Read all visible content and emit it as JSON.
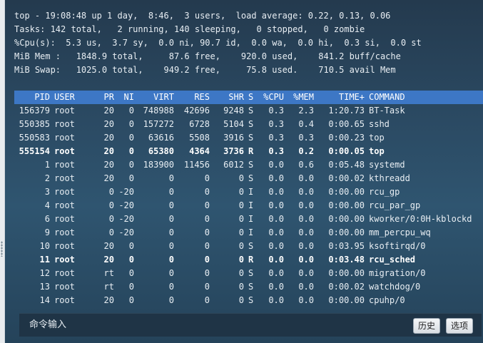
{
  "summary": [
    "top - 19:08:48 up 1 day,  8:46,  3 users,  load average: 0.22, 0.13, 0.06",
    "Tasks: 142 total,   2 running, 140 sleeping,   0 stopped,   0 zombie",
    "%Cpu(s):  5.3 us,  3.7 sy,  0.0 ni, 90.7 id,  0.0 wa,  0.0 hi,  0.3 si,  0.0 st",
    "MiB Mem :   1848.9 total,     87.6 free,    920.0 used,    841.2 buff/cache",
    "MiB Swap:   1025.0 total,    949.2 free,     75.8 used.    710.5 avail Mem"
  ],
  "columns": [
    "PID",
    "USER",
    "PR",
    "NI",
    "VIRT",
    "RES",
    "SHR",
    "S",
    "%CPU",
    "%MEM",
    "TIME+",
    "COMMAND"
  ],
  "processes": [
    {
      "pid": "156379",
      "user": "root",
      "pr": "20",
      "ni": "0",
      "virt": "748988",
      "res": "42696",
      "shr": "9248",
      "s": "S",
      "cpu": "0.3",
      "mem": "2.3",
      "time": "1:20.73",
      "command": "BT-Task",
      "bold": false
    },
    {
      "pid": "550385",
      "user": "root",
      "pr": "20",
      "ni": "0",
      "virt": "157272",
      "res": "6728",
      "shr": "5104",
      "s": "S",
      "cpu": "0.3",
      "mem": "0.4",
      "time": "0:00.65",
      "command": "sshd",
      "bold": false
    },
    {
      "pid": "550583",
      "user": "root",
      "pr": "20",
      "ni": "0",
      "virt": "63616",
      "res": "5508",
      "shr": "3916",
      "s": "S",
      "cpu": "0.3",
      "mem": "0.3",
      "time": "0:00.23",
      "command": "top",
      "bold": false
    },
    {
      "pid": "555154",
      "user": "root",
      "pr": "20",
      "ni": "0",
      "virt": "65380",
      "res": "4364",
      "shr": "3736",
      "s": "R",
      "cpu": "0.3",
      "mem": "0.2",
      "time": "0:00.05",
      "command": "top",
      "bold": true
    },
    {
      "pid": "1",
      "user": "root",
      "pr": "20",
      "ni": "0",
      "virt": "183900",
      "res": "11456",
      "shr": "6012",
      "s": "S",
      "cpu": "0.0",
      "mem": "0.6",
      "time": "0:05.48",
      "command": "systemd",
      "bold": false
    },
    {
      "pid": "2",
      "user": "root",
      "pr": "20",
      "ni": "0",
      "virt": "0",
      "res": "0",
      "shr": "0",
      "s": "S",
      "cpu": "0.0",
      "mem": "0.0",
      "time": "0:00.02",
      "command": "kthreadd",
      "bold": false
    },
    {
      "pid": "3",
      "user": "root",
      "pr": "0",
      "ni": "-20",
      "virt": "0",
      "res": "0",
      "shr": "0",
      "s": "I",
      "cpu": "0.0",
      "mem": "0.0",
      "time": "0:00.00",
      "command": "rcu_gp",
      "bold": false
    },
    {
      "pid": "4",
      "user": "root",
      "pr": "0",
      "ni": "-20",
      "virt": "0",
      "res": "0",
      "shr": "0",
      "s": "I",
      "cpu": "0.0",
      "mem": "0.0",
      "time": "0:00.00",
      "command": "rcu_par_gp",
      "bold": false
    },
    {
      "pid": "6",
      "user": "root",
      "pr": "0",
      "ni": "-20",
      "virt": "0",
      "res": "0",
      "shr": "0",
      "s": "I",
      "cpu": "0.0",
      "mem": "0.0",
      "time": "0:00.00",
      "command": "kworker/0:0H-kblockd",
      "bold": false
    },
    {
      "pid": "9",
      "user": "root",
      "pr": "0",
      "ni": "-20",
      "virt": "0",
      "res": "0",
      "shr": "0",
      "s": "I",
      "cpu": "0.0",
      "mem": "0.0",
      "time": "0:00.00",
      "command": "mm_percpu_wq",
      "bold": false
    },
    {
      "pid": "10",
      "user": "root",
      "pr": "20",
      "ni": "0",
      "virt": "0",
      "res": "0",
      "shr": "0",
      "s": "S",
      "cpu": "0.0",
      "mem": "0.0",
      "time": "0:03.95",
      "command": "ksoftirqd/0",
      "bold": false
    },
    {
      "pid": "11",
      "user": "root",
      "pr": "20",
      "ni": "0",
      "virt": "0",
      "res": "0",
      "shr": "0",
      "s": "R",
      "cpu": "0.0",
      "mem": "0.0",
      "time": "0:03.48",
      "command": "rcu_sched",
      "bold": true
    },
    {
      "pid": "12",
      "user": "root",
      "pr": "rt",
      "ni": "0",
      "virt": "0",
      "res": "0",
      "shr": "0",
      "s": "S",
      "cpu": "0.0",
      "mem": "0.0",
      "time": "0:00.00",
      "command": "migration/0",
      "bold": false
    },
    {
      "pid": "13",
      "user": "root",
      "pr": "rt",
      "ni": "0",
      "virt": "0",
      "res": "0",
      "shr": "0",
      "s": "S",
      "cpu": "0.0",
      "mem": "0.0",
      "time": "0:00.02",
      "command": "watchdog/0",
      "bold": false
    },
    {
      "pid": "14",
      "user": "root",
      "pr": "20",
      "ni": "0",
      "virt": "0",
      "res": "0",
      "shr": "0",
      "s": "S",
      "cpu": "0.0",
      "mem": "0.0",
      "time": "0:00.00",
      "command": "cpuhp/0",
      "bold": false
    }
  ],
  "command_bar": {
    "label": "命令输入",
    "history_button": "历史",
    "options_button": "选项"
  },
  "colors": {
    "background_top": "#243a4e",
    "header_bar": "#3d77c5",
    "text": "#e8eef3"
  }
}
